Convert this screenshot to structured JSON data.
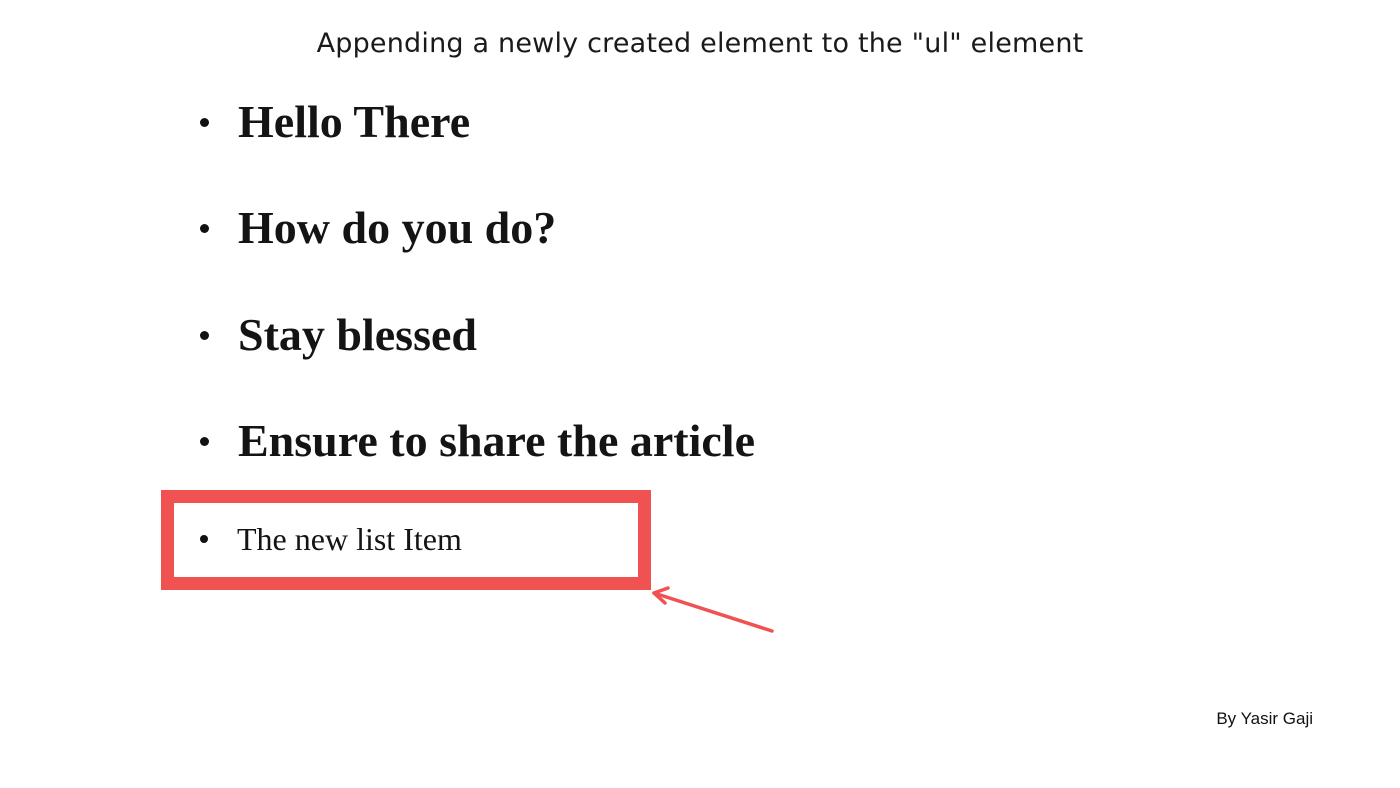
{
  "title": "Appending a newly created element to the \"ul\" element",
  "list": {
    "items": [
      {
        "label": "Hello There"
      },
      {
        "label": "How do you do?"
      },
      {
        "label": "Stay blessed"
      },
      {
        "label": "Ensure to share the article"
      }
    ],
    "new_item": {
      "label": "The new list Item"
    }
  },
  "highlight_color": "#f05252",
  "byline": "By Yasir Gaji"
}
